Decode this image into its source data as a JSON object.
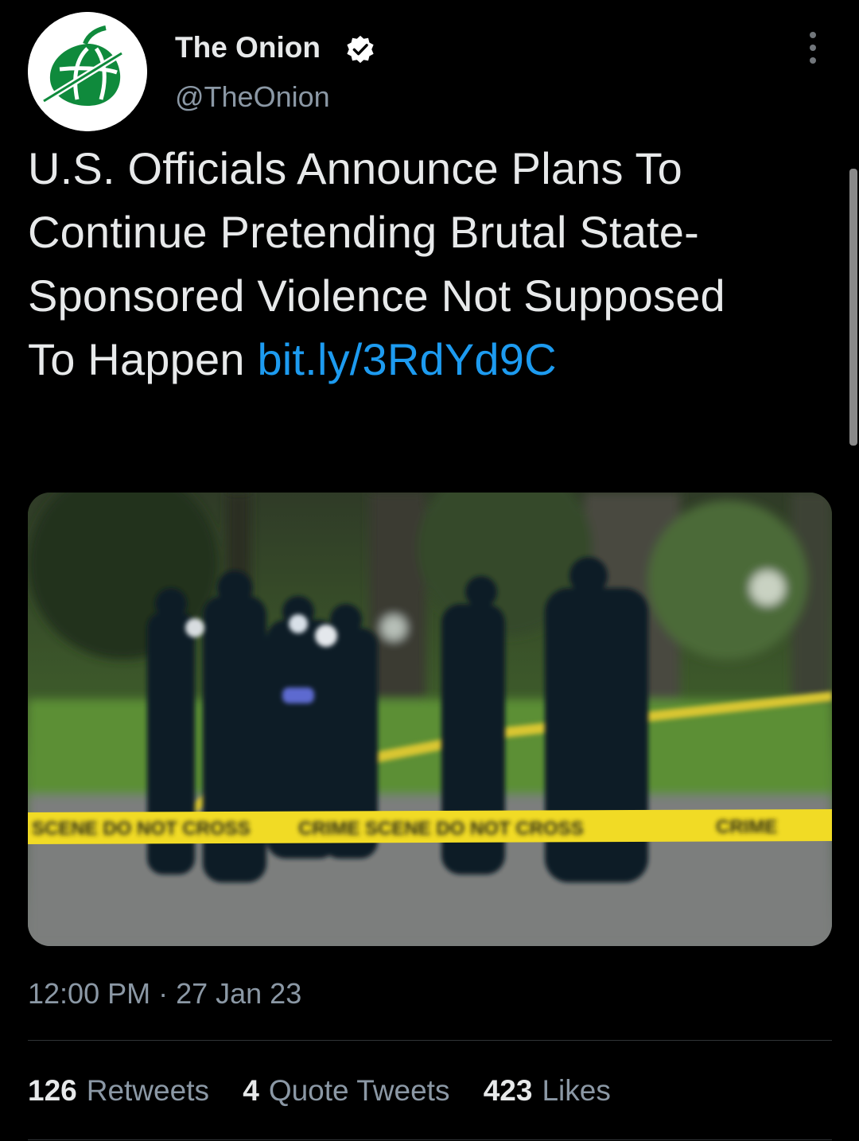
{
  "author": {
    "name": "The Onion",
    "handle": "@TheOnion",
    "verified": true,
    "avatar_icon": "onion-logo-icon",
    "brand_color": "#0f8a3c"
  },
  "tweet": {
    "text": "U.S. Officials Announce Plans To Continue Pretending Brutal State-Sponsored Violence Not Supposed To Happen ",
    "link": "bit.ly/3RdYd9C",
    "link_color": "#1d9bf0",
    "image_tape_text": "CRIME SCENE DO NOT CROSS"
  },
  "meta": {
    "timestamp": "12:00 PM · 27 Jan 23"
  },
  "stats": {
    "retweets_count": "126",
    "retweets_label": "Retweets",
    "quotes_count": "4",
    "quotes_label": "Quote Tweets",
    "likes_count": "423",
    "likes_label": "Likes"
  }
}
